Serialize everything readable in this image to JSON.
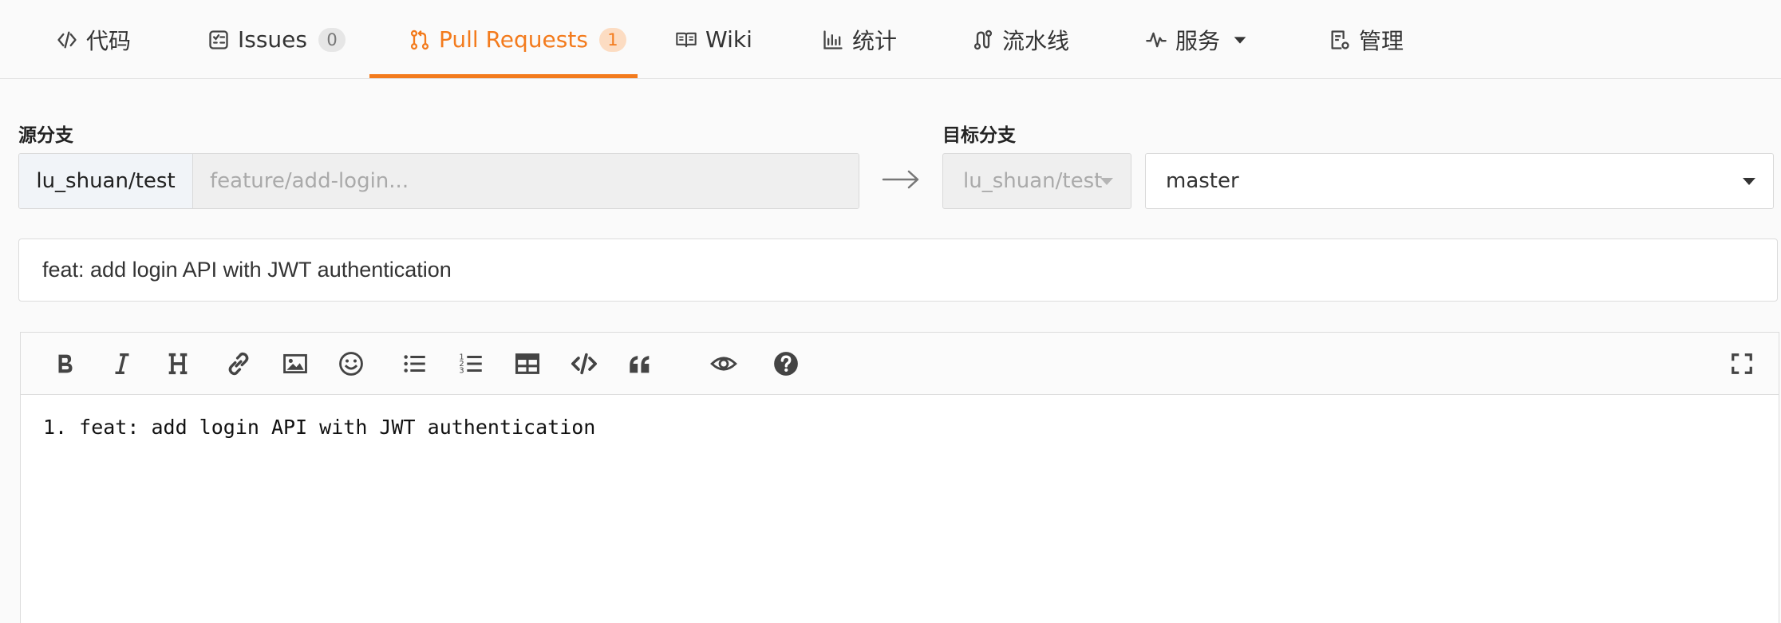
{
  "tabs": [
    {
      "label": "代码",
      "icon": "code-icon"
    },
    {
      "label": "Issues",
      "icon": "issues-icon",
      "badge": "0"
    },
    {
      "label": "Pull Requests",
      "icon": "pull-request-icon",
      "badge": "1",
      "active": true
    },
    {
      "label": "Wiki",
      "icon": "book-icon"
    },
    {
      "label": "统计",
      "icon": "bar-chart-icon"
    },
    {
      "label": "流水线",
      "icon": "pipeline-icon"
    },
    {
      "label": "服务",
      "icon": "pulse-icon",
      "dropdown": true
    },
    {
      "label": "管理",
      "icon": "settings-doc-icon"
    }
  ],
  "source": {
    "label": "源分支",
    "repo": "lu_shuan/test",
    "branch": "feature/add-login..."
  },
  "target": {
    "label": "目标分支",
    "repo": "lu_shuan/test",
    "branch": "master"
  },
  "title_value": "feat: add login API with JWT authentication",
  "editor": {
    "toolbar": [
      "bold-icon",
      "italic-icon",
      "heading-icon",
      "link-icon",
      "image-icon",
      "emoji-icon",
      "unordered-list-icon",
      "ordered-list-icon",
      "table-icon",
      "code-icon",
      "quote-icon",
      "preview-icon",
      "help-icon",
      "fullscreen-icon"
    ],
    "content": "1. feat: add login API with JWT authentication"
  },
  "colors": {
    "accent": "#f37b1d",
    "text": "#333333",
    "border": "#dcdcdc"
  }
}
